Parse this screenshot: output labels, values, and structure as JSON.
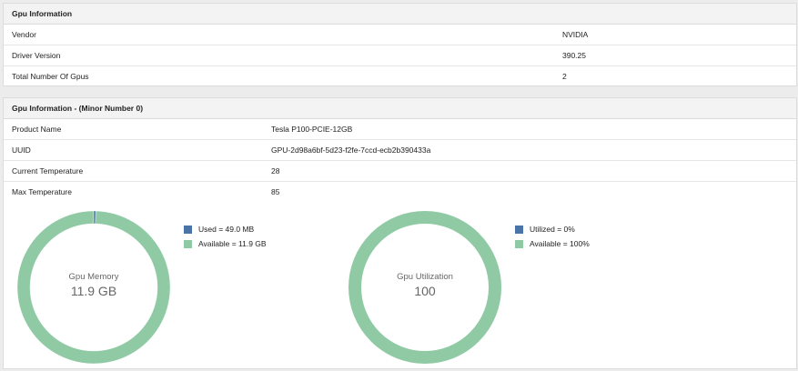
{
  "gpu_info": {
    "title": "Gpu Information",
    "rows": [
      {
        "label": "Vendor",
        "value": "NVIDIA"
      },
      {
        "label": "Driver Version",
        "value": "390.25"
      },
      {
        "label": "Total Number Of Gpus",
        "value": "2"
      }
    ]
  },
  "gpu_detail": {
    "title": "Gpu Information - (Minor Number 0)",
    "rows": [
      {
        "label": "Product Name",
        "value": "Tesla P100-PCIE-12GB"
      },
      {
        "label": "UUID",
        "value": "GPU-2d98a6bf-5d23-f2fe-7ccd-ecb2b390433a"
      },
      {
        "label": "Current Temperature",
        "value": "28"
      },
      {
        "label": "Max Temperature",
        "value": "85"
      }
    ],
    "memory_chart": {
      "title": "Gpu Memory",
      "center_value": "11.9 GB",
      "legend": [
        {
          "label": "Used = 49.0 MB",
          "color": "#4a74a8"
        },
        {
          "label": "Available = 11.9 GB",
          "color": "#8fcaa4"
        }
      ]
    },
    "utilization_chart": {
      "title": "Gpu Utilization",
      "center_value": "100",
      "legend": [
        {
          "label": "Utilized = 0%",
          "color": "#4a74a8"
        },
        {
          "label": "Available = 100%",
          "color": "#8fcaa4"
        }
      ]
    }
  },
  "chart_data": [
    {
      "type": "pie",
      "title": "Gpu Memory",
      "categories": [
        "Used",
        "Available"
      ],
      "values": [
        0.049,
        11.9
      ],
      "unit": "GB",
      "colors": [
        "#4a74a8",
        "#8fcaa4"
      ]
    },
    {
      "type": "pie",
      "title": "Gpu Utilization",
      "categories": [
        "Utilized",
        "Available"
      ],
      "values": [
        0,
        100
      ],
      "unit": "%",
      "colors": [
        "#4a74a8",
        "#8fcaa4"
      ]
    }
  ]
}
